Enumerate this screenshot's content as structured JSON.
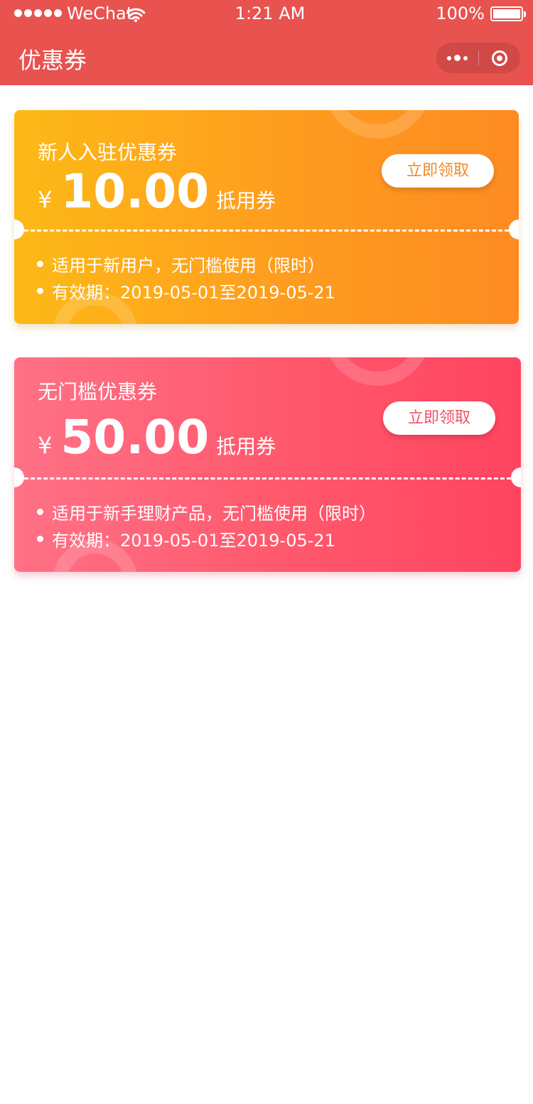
{
  "status": {
    "carrier": "WeChat",
    "time": "1:21 AM",
    "battery": "100%"
  },
  "nav": {
    "title": "优惠券"
  },
  "coupons": [
    {
      "title": "新人入驻优惠券",
      "currency": "¥",
      "amount": "10.00",
      "unit": "抵用券",
      "button": "立即领取",
      "rules": [
        "适用于新用户，无门槛使用（限时）",
        "有效期：2019-05-01至2019-05-21"
      ]
    },
    {
      "title": "无门槛优惠券",
      "currency": "¥",
      "amount": "50.00",
      "unit": "抵用券",
      "button": "立即领取",
      "rules": [
        "适用于新手理财产品，无门槛使用（限时）",
        "有效期：2019-05-01至2019-05-21"
      ]
    }
  ],
  "colors": {
    "header": "#e8524f",
    "orange_start": "#fdb916",
    "orange_end": "#fd8b22",
    "red_start": "#ff7186",
    "red_end": "#ff4460"
  }
}
